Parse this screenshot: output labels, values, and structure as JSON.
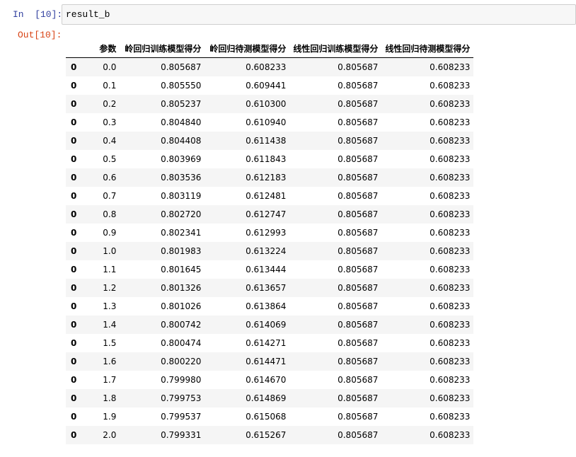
{
  "cell_in": {
    "prompt": "In  [10]:",
    "code": "result_b"
  },
  "cell_out": {
    "prompt": "Out[10]:"
  },
  "table": {
    "columns": [
      "",
      "参数",
      "岭回归训练模型得分",
      "岭回归待测模型得分",
      "线性回归训练模型得分",
      "线性回归待测模型得分"
    ],
    "rows": [
      [
        "0",
        "0.0",
        "0.805687",
        "0.608233",
        "0.805687",
        "0.608233"
      ],
      [
        "0",
        "0.1",
        "0.805550",
        "0.609441",
        "0.805687",
        "0.608233"
      ],
      [
        "0",
        "0.2",
        "0.805237",
        "0.610300",
        "0.805687",
        "0.608233"
      ],
      [
        "0",
        "0.3",
        "0.804840",
        "0.610940",
        "0.805687",
        "0.608233"
      ],
      [
        "0",
        "0.4",
        "0.804408",
        "0.611438",
        "0.805687",
        "0.608233"
      ],
      [
        "0",
        "0.5",
        "0.803969",
        "0.611843",
        "0.805687",
        "0.608233"
      ],
      [
        "0",
        "0.6",
        "0.803536",
        "0.612183",
        "0.805687",
        "0.608233"
      ],
      [
        "0",
        "0.7",
        "0.803119",
        "0.612481",
        "0.805687",
        "0.608233"
      ],
      [
        "0",
        "0.8",
        "0.802720",
        "0.612747",
        "0.805687",
        "0.608233"
      ],
      [
        "0",
        "0.9",
        "0.802341",
        "0.612993",
        "0.805687",
        "0.608233"
      ],
      [
        "0",
        "1.0",
        "0.801983",
        "0.613224",
        "0.805687",
        "0.608233"
      ],
      [
        "0",
        "1.1",
        "0.801645",
        "0.613444",
        "0.805687",
        "0.608233"
      ],
      [
        "0",
        "1.2",
        "0.801326",
        "0.613657",
        "0.805687",
        "0.608233"
      ],
      [
        "0",
        "1.3",
        "0.801026",
        "0.613864",
        "0.805687",
        "0.608233"
      ],
      [
        "0",
        "1.4",
        "0.800742",
        "0.614069",
        "0.805687",
        "0.608233"
      ],
      [
        "0",
        "1.5",
        "0.800474",
        "0.614271",
        "0.805687",
        "0.608233"
      ],
      [
        "0",
        "1.6",
        "0.800220",
        "0.614471",
        "0.805687",
        "0.608233"
      ],
      [
        "0",
        "1.7",
        "0.799980",
        "0.614670",
        "0.805687",
        "0.608233"
      ],
      [
        "0",
        "1.8",
        "0.799753",
        "0.614869",
        "0.805687",
        "0.608233"
      ],
      [
        "0",
        "1.9",
        "0.799537",
        "0.615068",
        "0.805687",
        "0.608233"
      ],
      [
        "0",
        "2.0",
        "0.799331",
        "0.615267",
        "0.805687",
        "0.608233"
      ]
    ]
  }
}
